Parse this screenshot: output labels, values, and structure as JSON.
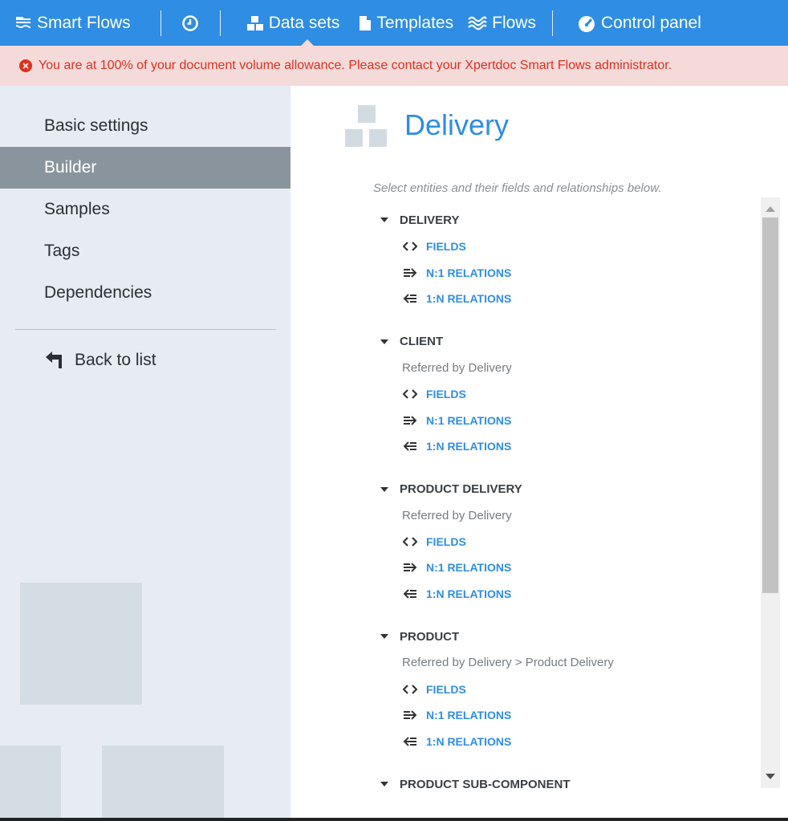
{
  "nav": {
    "brand_label": "Smart Flows",
    "datasets_label": "Data sets",
    "templates_label": "Templates",
    "flows_label": "Flows",
    "control_label": "Control panel"
  },
  "alert": {
    "message": "You are at 100% of your document volume allowance. Please contact your Xpertdoc Smart Flows administrator."
  },
  "sidebar": {
    "items": [
      {
        "label": "Basic settings"
      },
      {
        "label": "Builder"
      },
      {
        "label": "Samples"
      },
      {
        "label": "Tags"
      },
      {
        "label": "Dependencies"
      }
    ],
    "back_label": "Back to list"
  },
  "main": {
    "title": "Delivery",
    "hint": "Select entities and their fields and relationships below.",
    "entities": [
      {
        "name": "DELIVERY",
        "referred": ""
      },
      {
        "name": "CLIENT",
        "referred": "Referred by Delivery"
      },
      {
        "name": "PRODUCT DELIVERY",
        "referred": "Referred by Delivery"
      },
      {
        "name": "PRODUCT",
        "referred": "Referred by Delivery > Product Delivery"
      },
      {
        "name": "PRODUCT SUB-COMPONENT",
        "referred": ""
      }
    ],
    "links": {
      "fields": "FIELDS",
      "n1": "N:1 RELATIONS",
      "1n": "1:N RELATIONS"
    }
  },
  "colors": {
    "accent": "#2f8de4",
    "alert_bg": "#f5dada",
    "alert_text": "#d9321f",
    "sidebar_active": "#8a949d"
  }
}
